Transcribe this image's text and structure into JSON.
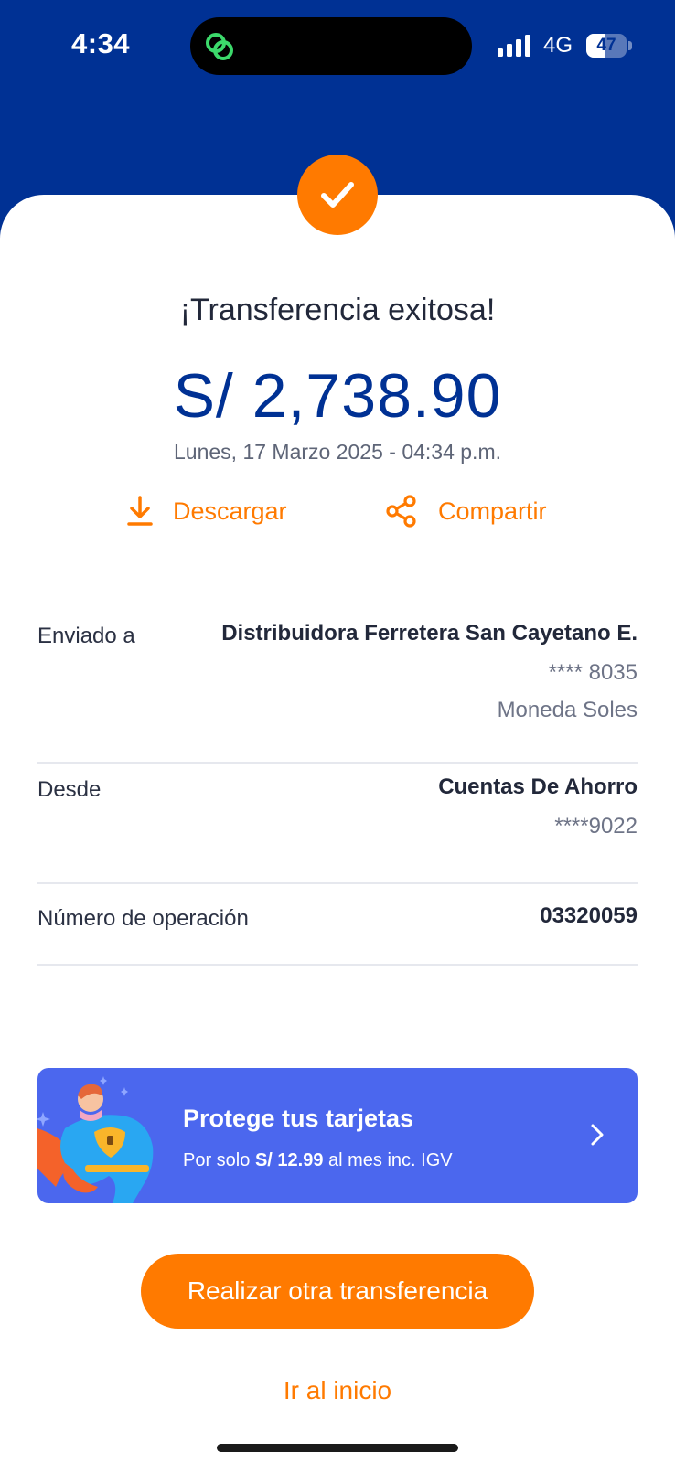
{
  "status_bar": {
    "time": "4:34",
    "network": "4G",
    "battery": "47",
    "battery_level": 0.47
  },
  "header": {
    "background_color": "#003194"
  },
  "success": {
    "icon": "check-icon",
    "title": "¡Transferencia exitosa!",
    "amount": "S/ 2,738.90",
    "datetime": "Lunes, 17 Marzo 2025 - 04:34 p.m."
  },
  "actions": {
    "download_label": "Descargar",
    "share_label": "Compartir"
  },
  "details": {
    "sent_to": {
      "label": "Enviado a",
      "name": "Distribuidora Ferretera San Cayetano E.",
      "account": "**** 8035",
      "currency": "Moneda Soles"
    },
    "from": {
      "label": "Desde",
      "account_type": "Cuentas De Ahorro",
      "account": "****9022"
    },
    "operation": {
      "label": "Número de operación",
      "value": "03320059"
    }
  },
  "promo": {
    "title": "Protege tus tarjetas",
    "sub_prefix": "Por solo ",
    "sub_price": "S/ 12.99",
    "sub_suffix": " al mes inc. IGV"
  },
  "buttons": {
    "primary": "Realizar otra transferencia",
    "home": "Ir al inicio"
  },
  "colors": {
    "accent": "#FF7A00",
    "brand_blue": "#003194",
    "promo_blue": "#4B67EE"
  }
}
